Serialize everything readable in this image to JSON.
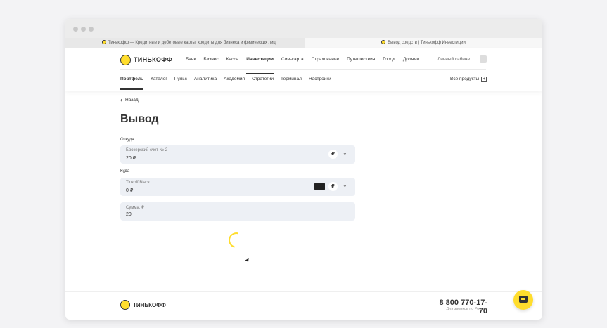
{
  "browser": {
    "tabs": [
      {
        "title": "Тинькофф — Кредитные и дебетовые карты, кредиты для бизнеса и физических лиц"
      },
      {
        "title": "Вывод средств | Тинькофф Инвестиции"
      }
    ]
  },
  "header": {
    "logo_text": "ТИНЬКОФФ",
    "nav": [
      "Банк",
      "Бизнес",
      "Касса",
      "Инвестиции",
      "Сим-карта",
      "Страхование",
      "Путешествия",
      "Город",
      "Долями"
    ],
    "active_nav": "Инвестиции",
    "login_label": "Личный кабинет",
    "subnav": [
      "Портфель",
      "Каталог",
      "Пульс",
      "Аналитика",
      "Академия",
      "Стратегии",
      "Терминал",
      "Настройки"
    ],
    "active_subnav": "Портфель",
    "all_products_label": "Все продукты"
  },
  "page": {
    "back_label": "Назад",
    "title": "Вывод",
    "from_label": "Откуда",
    "from_account": {
      "name": "Брокерский счет № 2",
      "balance": "20 ₽",
      "currency": "₽"
    },
    "to_label": "Куда",
    "to_account": {
      "name": "Tinkoff Black",
      "balance": "0 ₽",
      "currency": "₽"
    },
    "amount_field": {
      "label": "Сумма, ₽",
      "value": "20"
    }
  },
  "footer": {
    "logo_text": "ТИНЬКОФФ",
    "phone": "8 800 770-17-70",
    "phone_caption": "Для звонков по России"
  },
  "colors": {
    "accent": "#ffdd2d",
    "field_bg": "#edf0f5",
    "text": "#333333"
  }
}
